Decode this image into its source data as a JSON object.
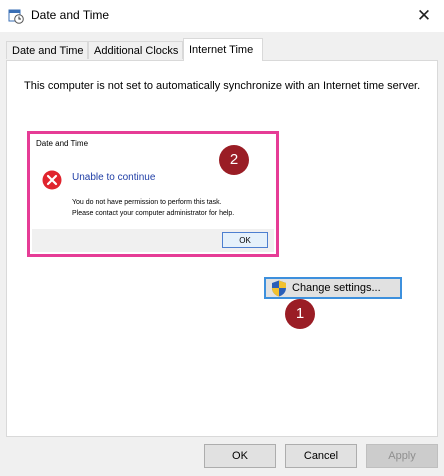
{
  "window": {
    "title": "Date and Time",
    "close_glyph": "✕",
    "icon": "clock-calendar-icon"
  },
  "tabs": [
    {
      "label": "Date and Time",
      "active": false
    },
    {
      "label": "Additional Clocks",
      "active": false
    },
    {
      "label": "Internet Time",
      "active": true
    }
  ],
  "internet_time": {
    "message": "This computer is not set to automatically synchronize with an Internet time server.",
    "change_settings_label": "Change settings...",
    "shield_icon": "uac-shield-icon"
  },
  "error_dialog": {
    "title": "Date and Time",
    "heading": "Unable to continue",
    "line1": "You do not have permission to perform this task.",
    "line2": "Please contact your computer administrator for help.",
    "ok_label": "OK",
    "icon": "error-icon",
    "highlight_color": "#e63c96"
  },
  "annotations": [
    {
      "label": "1",
      "color": "#9a1d25"
    },
    {
      "label": "2",
      "color": "#9a1d25"
    }
  ],
  "footer": {
    "ok_label": "OK",
    "cancel_label": "Cancel",
    "apply_label": "Apply",
    "apply_disabled": true
  }
}
